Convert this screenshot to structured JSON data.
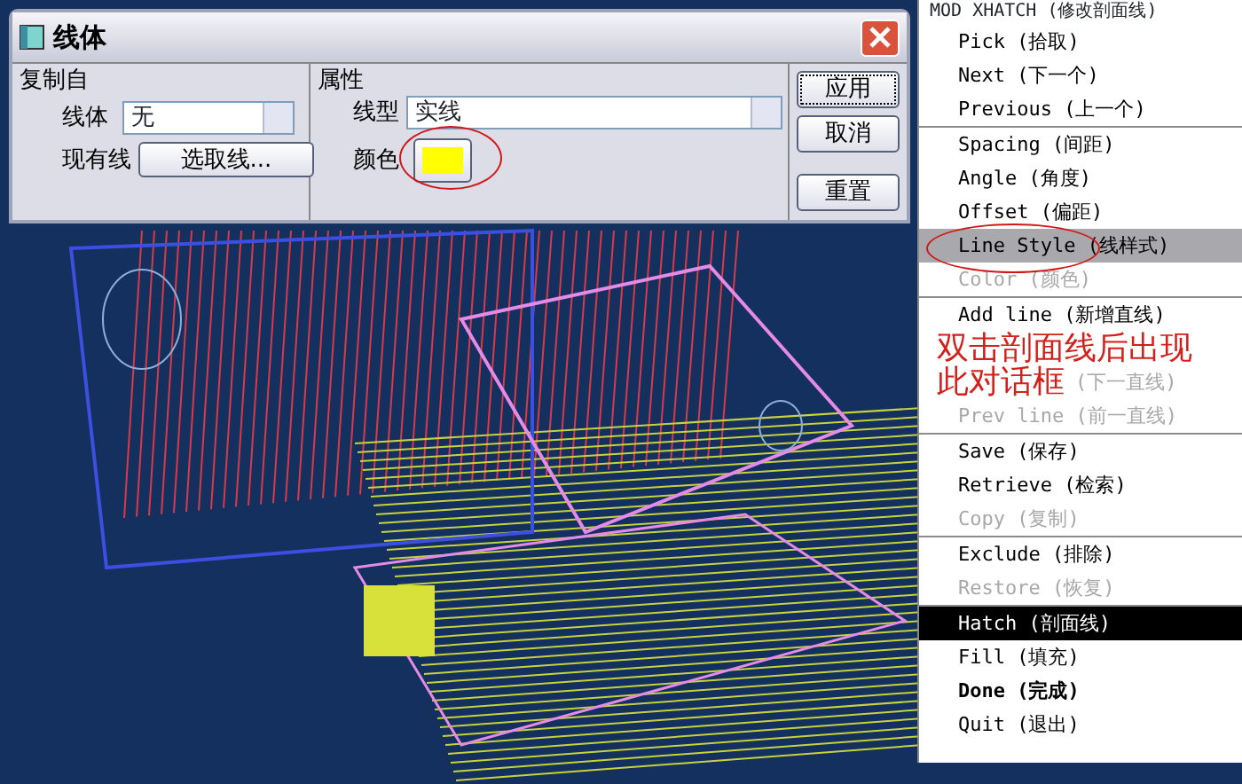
{
  "dialog": {
    "title": "线体",
    "copy_from": {
      "heading": "复制自",
      "font_label": "线体",
      "font_value": "无",
      "existing_label": "现有线",
      "select_button": "选取线..."
    },
    "attributes": {
      "heading": "属性",
      "type_label": "线型",
      "type_value": "实线",
      "color_label": "颜色",
      "color": "#ffff00"
    },
    "buttons": [
      {
        "label": "应用",
        "focused": true
      },
      {
        "label": "取消",
        "focused": false
      },
      {
        "label": "重置",
        "focused": false
      }
    ]
  },
  "menu": {
    "title": "MOD XHATCH (修改剖面线)",
    "groups": [
      [
        {
          "label": "Pick (拾取)",
          "disabled": false,
          "selected": false,
          "hovered": false,
          "bold": false
        },
        {
          "label": "Next (下一个)",
          "disabled": false,
          "selected": false,
          "hovered": false,
          "bold": false
        },
        {
          "label": "Previous (上一个)",
          "disabled": false,
          "selected": false,
          "hovered": false,
          "bold": false
        }
      ],
      [
        {
          "label": "Spacing (间距)",
          "disabled": false,
          "selected": false,
          "hovered": false,
          "bold": false
        },
        {
          "label": "Angle (角度)",
          "disabled": false,
          "selected": false,
          "hovered": false,
          "bold": false
        },
        {
          "label": "Offset (偏距)",
          "disabled": false,
          "selected": false,
          "hovered": false,
          "bold": false
        },
        {
          "label": "Line Style (线样式)",
          "disabled": false,
          "selected": false,
          "hovered": true,
          "bold": false
        },
        {
          "label": "Color (颜色)",
          "disabled": true,
          "selected": false,
          "hovered": false,
          "bold": false
        }
      ],
      [
        {
          "label": "Add line (新增直线)",
          "disabled": false,
          "selected": false,
          "hovered": false,
          "bold": false
        },
        {
          "note": "双击剖面线后出现"
        },
        {
          "label": "(下一直线)",
          "note": "此对话框",
          "disabled": true,
          "selected": false,
          "hovered": false,
          "bold": false
        },
        {
          "label": "Prev line (前一直线)",
          "disabled": true,
          "selected": false,
          "hovered": false,
          "bold": false
        }
      ],
      [
        {
          "label": "Save (保存)",
          "disabled": false,
          "selected": false,
          "hovered": false,
          "bold": false
        },
        {
          "label": "Retrieve (检索)",
          "disabled": false,
          "selected": false,
          "hovered": false,
          "bold": false
        },
        {
          "label": "Copy (复制)",
          "disabled": true,
          "selected": false,
          "hovered": false,
          "bold": false
        }
      ],
      [
        {
          "label": "Exclude (排除)",
          "disabled": false,
          "selected": false,
          "hovered": false,
          "bold": false
        },
        {
          "label": "Restore (恢复)",
          "disabled": true,
          "selected": false,
          "hovered": false,
          "bold": false
        }
      ],
      [
        {
          "label": "Hatch (剖面线)",
          "disabled": false,
          "selected": true,
          "hovered": false,
          "bold": false
        },
        {
          "label": "Fill (填充)",
          "disabled": false,
          "selected": false,
          "hovered": false,
          "bold": false
        },
        {
          "label": "Done (完成)",
          "disabled": false,
          "selected": false,
          "hovered": false,
          "bold": true
        },
        {
          "label": "Quit (退出)",
          "disabled": false,
          "selected": false,
          "hovered": false,
          "bold": false
        }
      ]
    ]
  }
}
